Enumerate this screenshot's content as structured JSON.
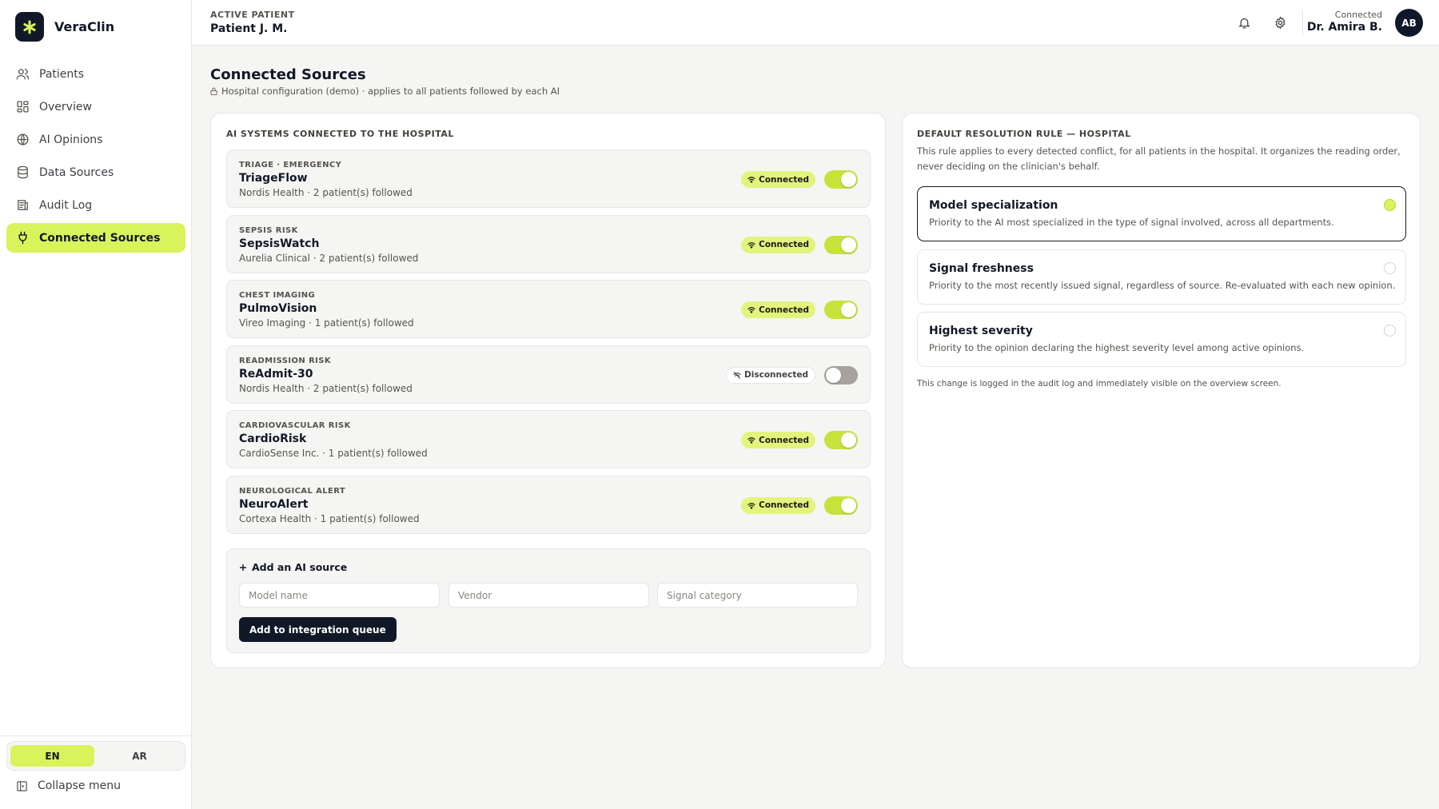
{
  "app": {
    "name": "VeraClin"
  },
  "sidebar": {
    "items": [
      {
        "label": "Patients",
        "icon": "users-icon"
      },
      {
        "label": "Overview",
        "icon": "grid-icon"
      },
      {
        "label": "AI Opinions",
        "icon": "globe-icon"
      },
      {
        "label": "Data Sources",
        "icon": "database-icon"
      },
      {
        "label": "Audit Log",
        "icon": "log-icon"
      },
      {
        "label": "Connected Sources",
        "icon": "plug-icon",
        "active": true
      }
    ],
    "languages": [
      "EN",
      "AR"
    ],
    "active_language": "EN",
    "collapse_label": "Collapse menu"
  },
  "header": {
    "active_patient_label": "ACTIVE PATIENT",
    "patient_name": "Patient J. M.",
    "user_status": "Connected",
    "user_name": "Dr. Amira B.",
    "user_initials": "AB"
  },
  "page": {
    "title": "Connected Sources",
    "subtitle": "Hospital configuration (demo) · applies to all patients followed by each AI"
  },
  "sources": {
    "heading": "AI SYSTEMS CONNECTED TO THE HOSPITAL",
    "items": [
      {
        "category": "TRIAGE · EMERGENCY",
        "name": "TriageFlow",
        "meta": "Nordis Health · 2 patient(s) followed",
        "status": "Connected",
        "connected": true
      },
      {
        "category": "SEPSIS RISK",
        "name": "SepsisWatch",
        "meta": "Aurelia Clinical · 2 patient(s) followed",
        "status": "Connected",
        "connected": true
      },
      {
        "category": "CHEST IMAGING",
        "name": "PulmoVision",
        "meta": "Vireo Imaging · 1 patient(s) followed",
        "status": "Connected",
        "connected": true
      },
      {
        "category": "READMISSION RISK",
        "name": "ReAdmit-30",
        "meta": "Nordis Health · 2 patient(s) followed",
        "status": "Disconnected",
        "connected": false
      },
      {
        "category": "CARDIOVASCULAR RISK",
        "name": "CardioRisk",
        "meta": "CardioSense Inc. · 1 patient(s) followed",
        "status": "Connected",
        "connected": true
      },
      {
        "category": "NEUROLOGICAL ALERT",
        "name": "NeuroAlert",
        "meta": "Cortexa Health · 1 patient(s) followed",
        "status": "Connected",
        "connected": true
      }
    ],
    "add": {
      "title": "Add an AI source",
      "model_placeholder": "Model name",
      "vendor_placeholder": "Vendor",
      "category_placeholder": "Signal category",
      "button_label": "Add to integration queue"
    }
  },
  "rule": {
    "heading": "DEFAULT RESOLUTION RULE — HOSPITAL",
    "description": "This rule applies to every detected conflict, for all patients in the hospital. It organizes the reading order, never deciding on the clinician's behalf.",
    "options": [
      {
        "title": "Model specialization",
        "text": "Priority to the AI most specialized in the type of signal involved, across all departments.",
        "selected": true
      },
      {
        "title": "Signal freshness",
        "text": "Priority to the most recently issued signal, regardless of source. Re-evaluated with each new opinion.",
        "selected": false
      },
      {
        "title": "Highest severity",
        "text": "Priority to the opinion declaring the highest severity level among active opinions.",
        "selected": false
      }
    ],
    "note": "This change is logged in the audit log and immediately visible on the overview screen."
  },
  "colors": {
    "accent": "#d9f45b",
    "toggle_on": "#c7e23a",
    "dark": "#111827",
    "background": "#f5f5f4"
  }
}
